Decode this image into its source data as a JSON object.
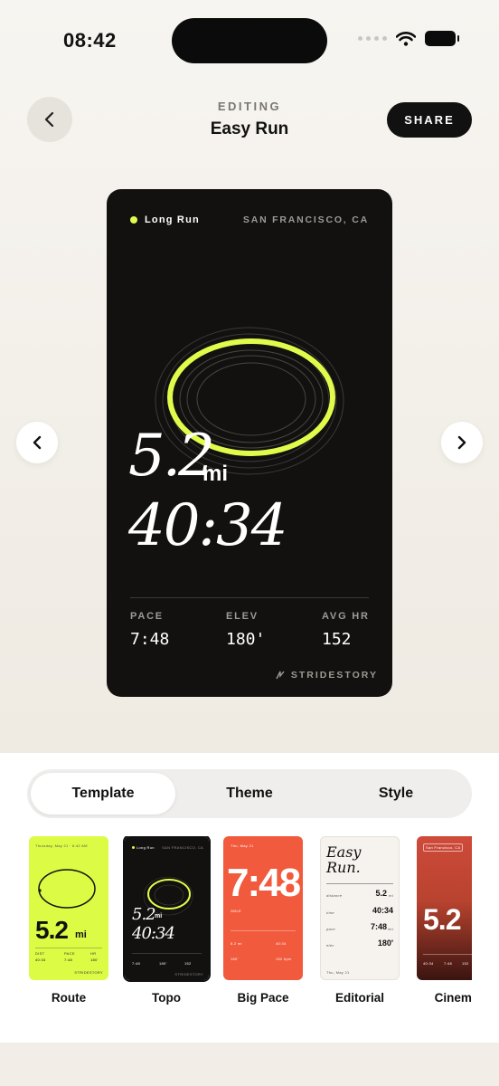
{
  "status_bar": {
    "time": "08:42"
  },
  "header": {
    "eyebrow": "EDITING",
    "title": "Easy Run",
    "share_label": "SHARE"
  },
  "card": {
    "tag": "Long Run",
    "location": "SAN FRANCISCO, CA",
    "distance": "5.2",
    "distance_unit": "mi",
    "time": "40:34",
    "stats": [
      {
        "label": "PACE",
        "value": "7:48"
      },
      {
        "label": "ELEV",
        "value": "180'"
      },
      {
        "label": "AVG HR",
        "value": "152"
      }
    ],
    "brand": "STRIDESTORY",
    "accent_color": "#e2fb4b"
  },
  "tabs": [
    {
      "label": "Template",
      "active": true
    },
    {
      "label": "Theme",
      "active": false
    },
    {
      "label": "Style",
      "active": false
    }
  ],
  "templates": [
    {
      "label": "Route",
      "header": "Thursday, May 21 · 6:42 AM",
      "distance": "5.2",
      "unit": "mi",
      "stats": [
        "DIST",
        "PACE",
        "HR"
      ],
      "values": [
        "40:34",
        "7:48",
        "180'"
      ],
      "brand": "STRIDESTORY"
    },
    {
      "label": "Topo",
      "tag": "Long Run",
      "location": "SAN FRANCISCO, CA",
      "distance": "5.2",
      "unit": "mi",
      "time": "40:34",
      "values": [
        "7:48",
        "180'",
        "152"
      ],
      "brand": "STRIDESTORY"
    },
    {
      "label": "Big Pace",
      "header": "Thu, May 21",
      "pace": "7:48",
      "pace_unit": "/MILE",
      "values": [
        "5.2 mi",
        "40:34",
        "180'",
        "152 bpm"
      ]
    },
    {
      "label": "Editorial",
      "title_line1": "Easy",
      "title_line2": "Run.",
      "rows": [
        {
          "label": "distance",
          "value": "5.2",
          "unit": "mi"
        },
        {
          "label": "time",
          "value": "40:34",
          "unit": ""
        },
        {
          "label": "pace",
          "value": "7:48",
          "unit": "/mi"
        },
        {
          "label": "elev",
          "value": "180'",
          "unit": ""
        }
      ],
      "footer": "Thu, May 21"
    },
    {
      "label": "Cinema",
      "header": "San Francisco, CA",
      "distance": "5.2",
      "values": [
        "40:34",
        "7:48",
        "152"
      ]
    }
  ]
}
